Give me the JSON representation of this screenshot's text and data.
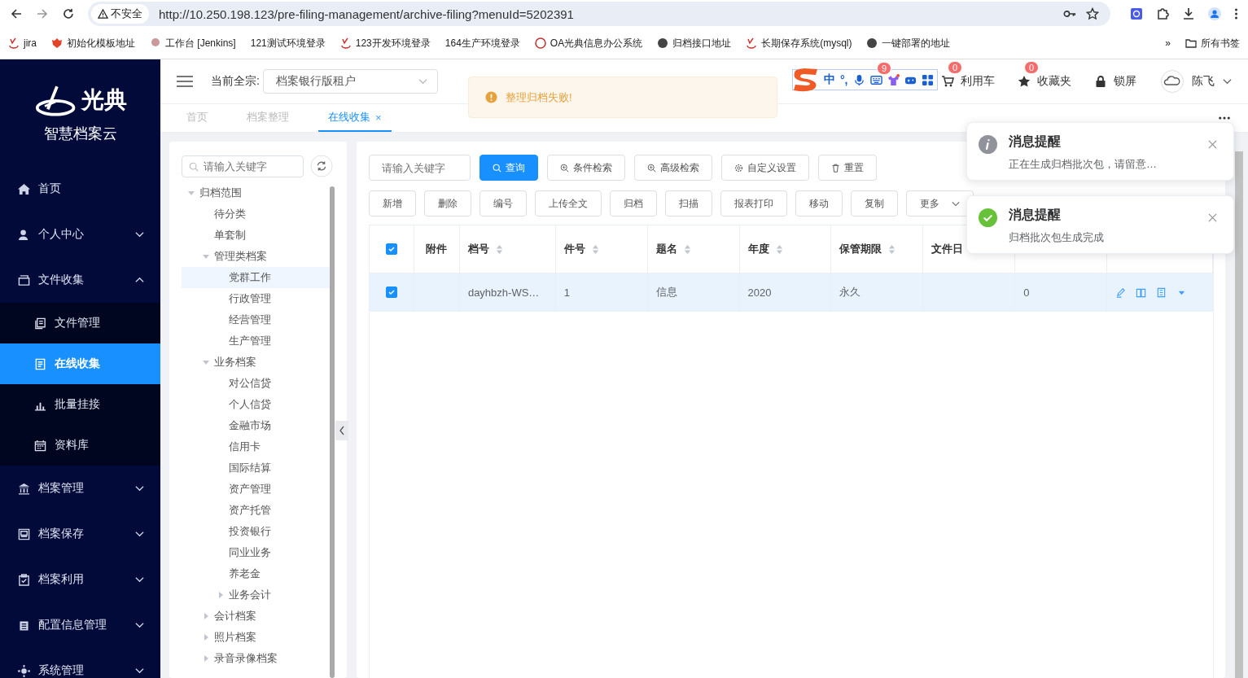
{
  "browser": {
    "security": "不安全",
    "url": "http://10.250.198.123/pre-filing-management/archive-filing?menuId=5202391",
    "bookmarks": [
      {
        "label": "jira"
      },
      {
        "label": "初始化模板地址"
      },
      {
        "label": "工作台 [Jenkins]"
      },
      {
        "label": "121测试环境登录"
      },
      {
        "label": "123开发环境登录"
      },
      {
        "label": "164生产环境登录"
      },
      {
        "label": "OA光典信息办公系统"
      },
      {
        "label": "归档接口地址"
      },
      {
        "label": "长期保存系统(mysql)"
      },
      {
        "label": "一键部署的地址"
      }
    ],
    "more": "»",
    "all_bookmarks": "所有书签"
  },
  "brand": {
    "logo": "光典",
    "subtitle": "智慧档案云"
  },
  "sidebar": {
    "items": [
      {
        "label": "首页",
        "expandable": false
      },
      {
        "label": "个人中心",
        "expandable": true,
        "expanded": false
      },
      {
        "label": "文件收集",
        "expandable": true,
        "expanded": true,
        "children": [
          {
            "label": "文件管理",
            "selected": false
          },
          {
            "label": "在线收集",
            "selected": true
          },
          {
            "label": "批量挂接",
            "selected": false
          },
          {
            "label": "资料库",
            "selected": false
          }
        ]
      },
      {
        "label": "档案管理",
        "expandable": true,
        "expanded": false
      },
      {
        "label": "档案保存",
        "expandable": true,
        "expanded": false
      },
      {
        "label": "档案利用",
        "expandable": true,
        "expanded": false
      },
      {
        "label": "配置信息管理",
        "expandable": true,
        "expanded": false
      },
      {
        "label": "系统管理",
        "expandable": true,
        "expanded": false
      }
    ]
  },
  "header": {
    "fonds_label": "当前全宗:",
    "fonds_value": "档案银行版租户",
    "message_badge": "9",
    "cart": {
      "label": "利用车",
      "badge": "0"
    },
    "favorites": {
      "label": "收藏夹",
      "badge": "0"
    },
    "lock": "锁屏",
    "user": "陈飞"
  },
  "ime_toolbar": {
    "mode": "中",
    "punct": "°,"
  },
  "alert": {
    "kind": "warning",
    "text": "整理归档失败!"
  },
  "tabs": [
    {
      "label": "首页",
      "selected": false,
      "closable": false
    },
    {
      "label": "档案整理",
      "selected": false,
      "closable": false
    },
    {
      "label": "在线收集",
      "selected": true,
      "closable": true
    }
  ],
  "tabs_close": "×",
  "tree": {
    "search_placeholder": "请输入关键字",
    "items": [
      {
        "label": "归档范围",
        "expanded": true,
        "selected": false,
        "children": [
          {
            "label": "待分类",
            "selected": false
          },
          {
            "label": "单套制",
            "selected": false
          },
          {
            "label": "管理类档案",
            "expanded": true,
            "selected": false,
            "children": [
              {
                "label": "党群工作",
                "selected": true
              },
              {
                "label": "行政管理",
                "selected": false
              },
              {
                "label": "经营管理",
                "selected": false
              },
              {
                "label": "生产管理",
                "selected": false
              }
            ]
          },
          {
            "label": "业务档案",
            "expanded": true,
            "selected": false,
            "children": [
              {
                "label": "对公信贷",
                "selected": false
              },
              {
                "label": "个人信贷",
                "selected": false
              },
              {
                "label": "金融市场",
                "selected": false
              },
              {
                "label": "信用卡",
                "selected": false
              },
              {
                "label": "国际结算",
                "selected": false
              },
              {
                "label": "资产管理",
                "selected": false
              },
              {
                "label": "资产托管",
                "selected": false
              },
              {
                "label": "投资银行",
                "selected": false
              },
              {
                "label": "同业业务",
                "selected": false
              },
              {
                "label": "养老金",
                "selected": false
              },
              {
                "label": "业务会计",
                "expanded": false,
                "selected": false
              }
            ]
          },
          {
            "label": "会计档案",
            "expanded": false,
            "selected": false
          },
          {
            "label": "照片档案",
            "expanded": false,
            "selected": false
          },
          {
            "label": "录音录像档案",
            "expanded": false,
            "selected": false
          }
        ]
      }
    ]
  },
  "search": {
    "placeholder": "请输入关键字",
    "buttons": [
      {
        "label": "查询",
        "kind": "primary"
      },
      {
        "label": "条件检索",
        "kind": "plain"
      },
      {
        "label": "高级检索",
        "kind": "plain"
      },
      {
        "label": "自定义设置",
        "kind": "plain"
      },
      {
        "label": "重置",
        "kind": "plain"
      }
    ]
  },
  "actions": [
    {
      "label": "新增",
      "dropdown": false
    },
    {
      "label": "删除",
      "dropdown": false
    },
    {
      "label": "编号",
      "dropdown": false
    },
    {
      "label": "上传全文",
      "dropdown": false
    },
    {
      "label": "归档",
      "dropdown": false
    },
    {
      "label": "扫描",
      "dropdown": false
    },
    {
      "label": "报表打印",
      "dropdown": false
    },
    {
      "label": "移动",
      "dropdown": false
    },
    {
      "label": "复制",
      "dropdown": false
    },
    {
      "label": "更多",
      "dropdown": true
    }
  ],
  "table": {
    "all_checked": true,
    "columns": [
      {
        "label": "附件",
        "sortable": false
      },
      {
        "label": "档号",
        "sortable": true
      },
      {
        "label": "件号",
        "sortable": true
      },
      {
        "label": "题名",
        "sortable": true
      },
      {
        "label": "年度",
        "sortable": true
      },
      {
        "label": "保管期限",
        "sortable": true
      },
      {
        "label": "文件日"
      }
    ],
    "rows": [
      {
        "selected": true,
        "checked": true,
        "cells": [
          "",
          "dayhbzh-WS…",
          "1",
          "信息",
          "2020",
          "永久",
          "",
          "0"
        ]
      }
    ]
  },
  "notifications": [
    {
      "kind": "info",
      "title": "消息提醒",
      "message": "正在生成归档批次包，请留意…"
    },
    {
      "kind": "success",
      "title": "消息提醒",
      "message": "归档批次包生成完成"
    }
  ]
}
